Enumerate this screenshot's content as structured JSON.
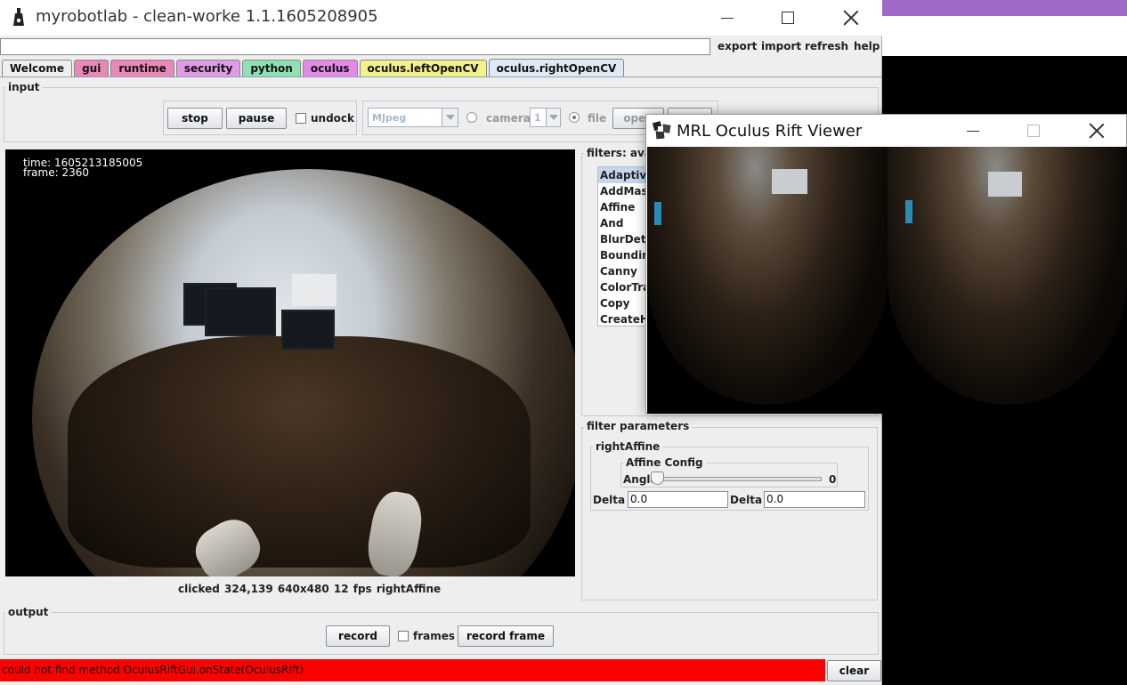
{
  "window": {
    "title": "myrobotlab - clean-worke 1.1.1605208905",
    "controls": {
      "minimize": "minimize-icon",
      "maximize": "maximize-icon",
      "close": "close-icon"
    }
  },
  "menu": {
    "input_value": "",
    "export": "export",
    "import": "import",
    "refresh": "refresh",
    "help": "help"
  },
  "tabs": [
    {
      "label": "Welcome",
      "color": "#eeeeee"
    },
    {
      "label": "gui",
      "color": "#e887b8"
    },
    {
      "label": "runtime",
      "color": "#e887b8"
    },
    {
      "label": "security",
      "color": "#e09be6"
    },
    {
      "label": "python",
      "color": "#8fe0b4"
    },
    {
      "label": "oculus",
      "color": "#e38ae8"
    },
    {
      "label": "oculus.leftOpenCV",
      "color": "#f4f08a"
    },
    {
      "label": "oculus.rightOpenCV",
      "color": "#dfe9f5"
    }
  ],
  "input": {
    "group_title": "input",
    "stop": "stop",
    "pause": "pause",
    "undock": "undock",
    "grabber": "MJpeg",
    "camera": "camera",
    "camera_index": "1",
    "file": "file",
    "open": "open"
  },
  "video": {
    "overlay_time": "time:  1605213185005",
    "overlay_frame": "frame: 2360",
    "status": "clicked 324,139  640x480  12 fps  rightAffine"
  },
  "filters": {
    "group_title": "filters: avail",
    "items": [
      "AdaptiveThreshold",
      "AddMask",
      "Affine",
      "And",
      "BlurDetector",
      "BoundingBox",
      "Canny",
      "ColorTrack",
      "Copy",
      "CreateHistogram"
    ],
    "selected_index": 0
  },
  "filter_params": {
    "group_title": "filter parameters",
    "filter_name": "rightAffine",
    "config_title": "Affine Config",
    "angle_label": "Angle",
    "angle_value": "0",
    "delta_x_label": "Delta X",
    "delta_x_value": "0.0",
    "delta_y_label": "Delta Y",
    "delta_y_value": "0.0"
  },
  "output": {
    "group_title": "output",
    "record": "record",
    "frames": "frames",
    "record_frame": "record frame"
  },
  "status_bar": {
    "message": "could not find method OculusRiftGui.onState(OculusRift)",
    "clear": "clear",
    "color": "#ff0000"
  },
  "oculus_viewer": {
    "title": "MRL Oculus Rift Viewer"
  }
}
